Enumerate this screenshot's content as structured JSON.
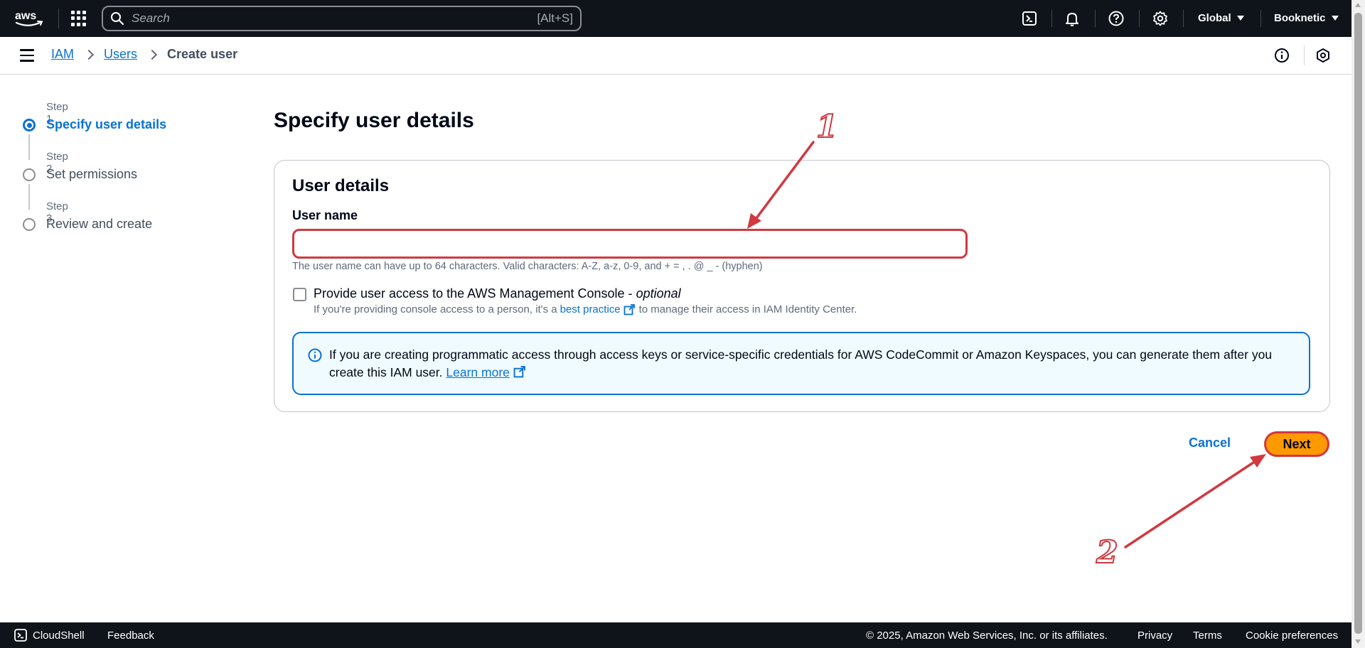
{
  "topnav": {
    "search_placeholder": "Search",
    "search_shortcut": "[Alt+S]",
    "region": "Global",
    "account": "Booknetic",
    "icons": [
      "aws-logo",
      "apps-icon",
      "search-icon",
      "cloudshell-icon",
      "bell-icon",
      "help-icon",
      "gear-icon"
    ]
  },
  "breadcrumb": {
    "items": [
      "IAM",
      "Users"
    ],
    "current": "Create user"
  },
  "steps": [
    {
      "num": "Step 1",
      "title": "Specify user details",
      "active": true
    },
    {
      "num": "Step 2",
      "title": "Set permissions",
      "active": false
    },
    {
      "num": "Step 3",
      "title": "Review and create",
      "active": false
    }
  ],
  "main": {
    "title": "Specify user details",
    "section_title": "User details",
    "username_label": "User name",
    "username_value": "",
    "username_hint": "The user name can have up to 64 characters. Valid characters: A-Z, a-z, 0-9, and + = , . @ _ - (hyphen)",
    "console_access_label": "Provide user access to the AWS Management Console - ",
    "console_access_optional": "optional",
    "console_access_checked": false,
    "console_desc_prefix": "If you're providing console access to a person, it's a",
    "console_desc_link": "best practice",
    "console_desc_suffix": "to manage their access in IAM Identity Center.",
    "info_text": "If you are creating programmatic access through access keys or service-specific credentials for AWS CodeCommit or Amazon Keyspaces, you can generate them after you create this IAM user.",
    "info_link": "Learn more"
  },
  "actions": {
    "cancel": "Cancel",
    "next": "Next"
  },
  "annotations": {
    "label_1": "1",
    "label_2": "2",
    "color": "#d13840"
  },
  "footer": {
    "cloudshell": "CloudShell",
    "feedback": "Feedback",
    "copyright": "© 2025, Amazon Web Services, Inc. or its affiliates.",
    "privacy": "Privacy",
    "terms": "Terms",
    "cookies": "Cookie preferences"
  },
  "colors": {
    "nav_bg": "#0f141a",
    "link": "#0972d3",
    "primary_button": "#ff9900",
    "info_bg": "#f0fbff"
  }
}
